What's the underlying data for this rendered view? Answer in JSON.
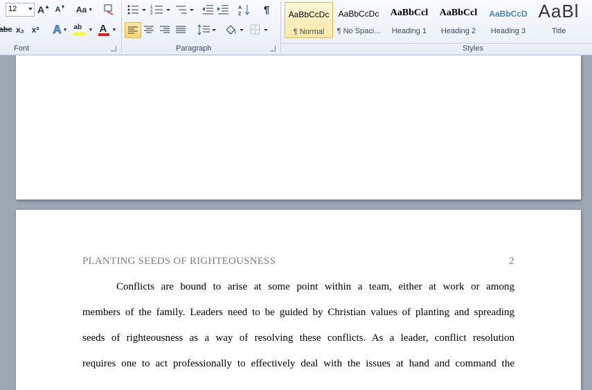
{
  "font_group": {
    "label": "Font",
    "font_size": "12",
    "grow_font": "A",
    "shrink_font": "A",
    "change_case": "Aa",
    "strikethrough": "abc",
    "subscript": "x₂",
    "superscript": "x²",
    "font_color_letter": "A",
    "text_effects_letter": "A",
    "highlight_letters": "ab"
  },
  "paragraph_group": {
    "label": "Paragraph",
    "pilcrow": "¶"
  },
  "styles_group": {
    "label": "Styles",
    "items": [
      {
        "sample": "AaBbCcDc",
        "name": "¶ Normal"
      },
      {
        "sample": "AaBbCcDc",
        "name": "¶ No Spaci..."
      },
      {
        "sample": "AaBbCcl",
        "name": "Heading 1"
      },
      {
        "sample": "AaBbCcl",
        "name": "Heading 2"
      },
      {
        "sample": "AaBbCcD",
        "name": "Heading 3"
      },
      {
        "sample": "AaBl",
        "name": "Title"
      }
    ]
  },
  "document": {
    "running_header": "PLANTING SEEDS OF RIGHTEOUSNESS",
    "page_number": "2",
    "lines": [
      "Conflicts are bound to arise at some point within a team, either at work or among",
      "members of the family. Leaders need to be guided by Christian values of planting and spreading",
      "seeds of righteousness as a way of resolving these conflicts. As a leader, conflict resolution",
      "requires one to act professionally to effectively deal with the issues at hand and command the"
    ]
  },
  "colors": {
    "active_style_border": "#e4b64b",
    "font_color_bar": "#e02020",
    "highlight_bar": "#ffff00",
    "heading_blue": "#4f81bd"
  }
}
